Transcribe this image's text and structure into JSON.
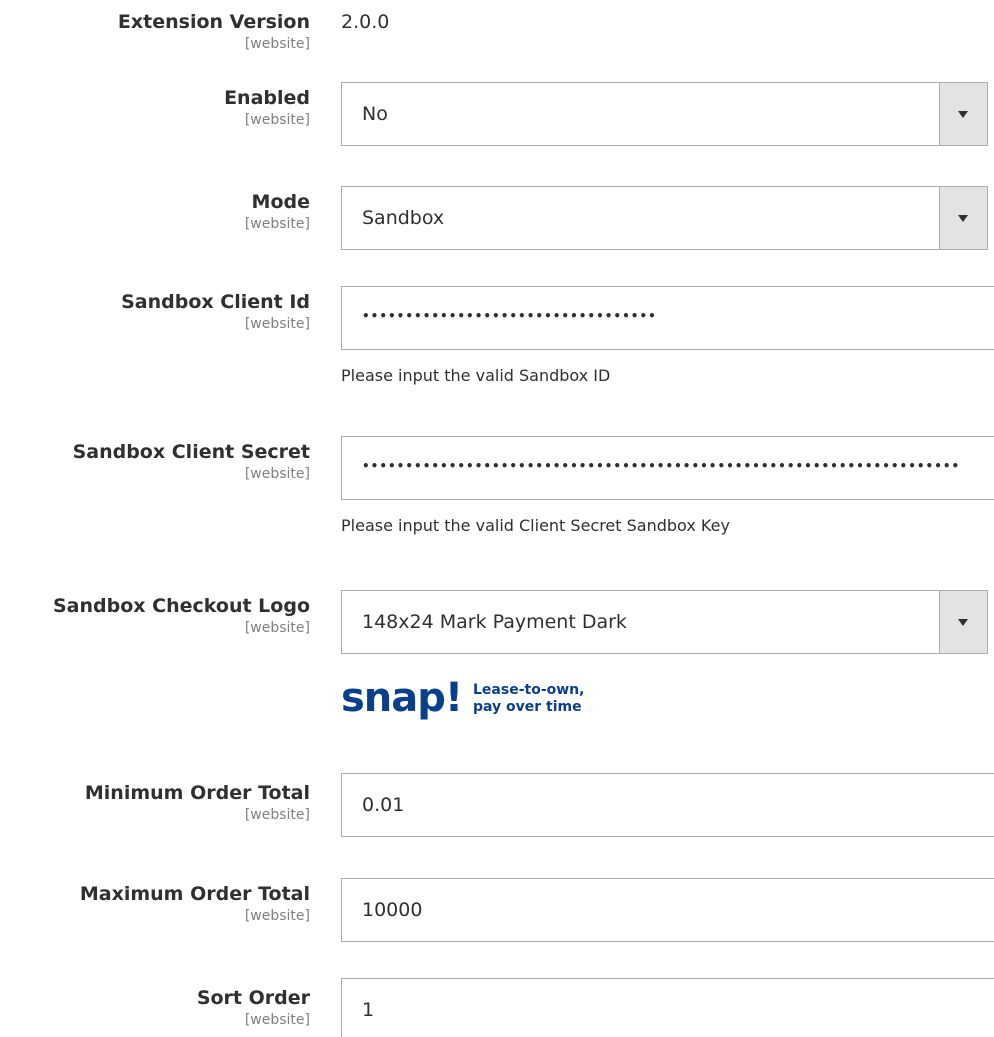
{
  "fields": {
    "extension_version": {
      "label": "Extension Version",
      "scope": "[website]",
      "value": "2.0.0"
    },
    "enabled": {
      "label": "Enabled",
      "scope": "[website]",
      "value": "No"
    },
    "mode": {
      "label": "Mode",
      "scope": "[website]",
      "value": "Sandbox"
    },
    "sandbox_client_id": {
      "label": "Sandbox Client Id",
      "scope": "[website]",
      "value": "••••••••••••••••••••••••••••••••••",
      "note": "Please input the valid Sandbox ID"
    },
    "sandbox_client_secret": {
      "label": "Sandbox Client Secret",
      "scope": "[website]",
      "value": "•••••••••••••••••••••••••••••••••••••••••••••••••••••••••••••••••••••",
      "note": "Please input the valid Client Secret Sandbox Key"
    },
    "sandbox_checkout_logo": {
      "label": "Sandbox Checkout Logo",
      "scope": "[website]",
      "value": "148x24 Mark Payment Dark"
    },
    "minimum_order_total": {
      "label": "Minimum Order Total",
      "scope": "[website]",
      "value": "0.01"
    },
    "maximum_order_total": {
      "label": "Maximum Order Total",
      "scope": "[website]",
      "value": "10000"
    },
    "sort_order": {
      "label": "Sort Order",
      "scope": "[website]",
      "value": "1"
    }
  },
  "logo_preview": {
    "brand": "snap!",
    "tagline_line1": "Lease-to-own,",
    "tagline_line2": "pay over time",
    "color": "#0a3f8c"
  },
  "icons": {
    "select_arrow": "chevron-down-icon"
  }
}
